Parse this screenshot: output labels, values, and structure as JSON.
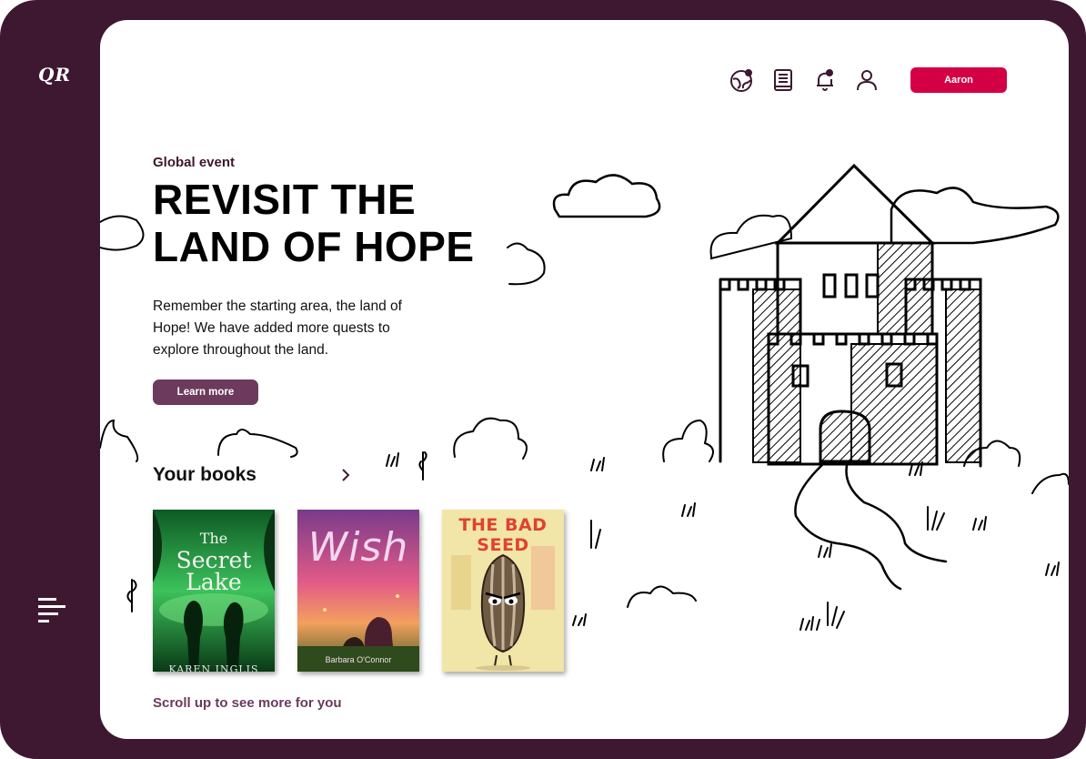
{
  "app": {
    "logo": "QR"
  },
  "header": {
    "icons": [
      "globe-icon",
      "book-icon",
      "bell-icon",
      "user-icon"
    ],
    "user_button": "Aaron"
  },
  "hero": {
    "eyebrow": "Global event",
    "title_line1": "REVISIT THE",
    "title_line2": "LAND OF HOPE",
    "description": "Remember the starting area, the land of Hope! We have added more quests to explore throughout the land.",
    "cta": "Learn more"
  },
  "books": {
    "title": "Your books",
    "items": [
      {
        "title_small": "The",
        "title_main1": "Secret",
        "title_main2": "Lake",
        "author": "KAREN INGLIS"
      },
      {
        "title": "Wish",
        "author": "Barbara O'Connor"
      },
      {
        "title": "THE BAD SEED"
      }
    ]
  },
  "footer": {
    "scroll_hint": "Scroll up to see more for you"
  },
  "colors": {
    "frame": "#3d1830",
    "accent": "#d40045",
    "button": "#6c3a5c"
  }
}
